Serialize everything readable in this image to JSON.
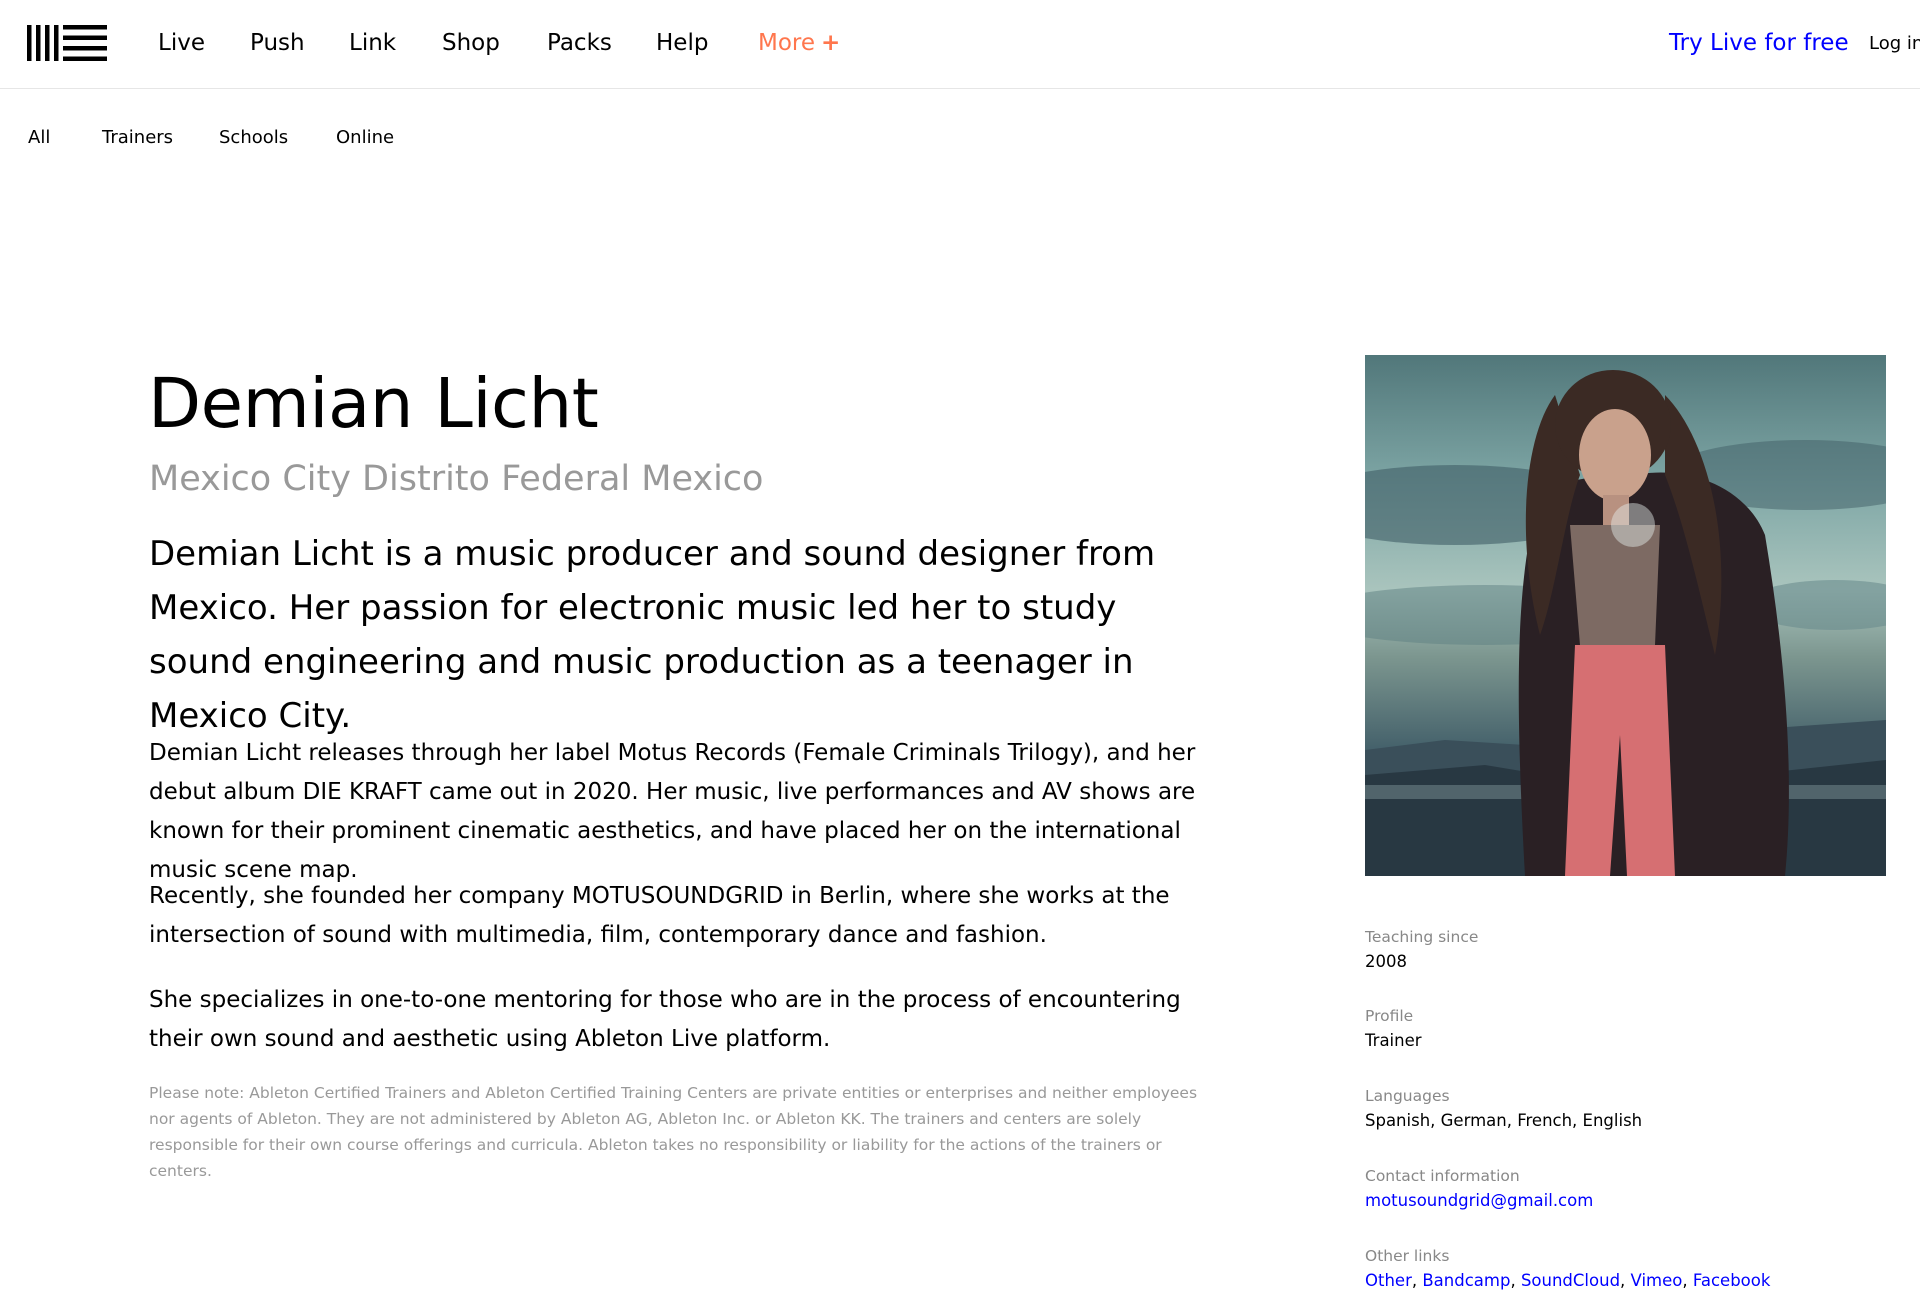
{
  "header": {
    "logo_label": "Ableton",
    "nav": [
      "Live",
      "Push",
      "Link",
      "Shop",
      "Packs",
      "Help"
    ],
    "more_label": "More",
    "more_icon": "+",
    "try_live": "Try Live for free",
    "login": "Log in"
  },
  "subnav": [
    "All",
    "Trainers",
    "Schools",
    "Online"
  ],
  "profile": {
    "name": "Demian Licht",
    "location": "Mexico City Distrito Federal Mexico",
    "intro": "Demian Licht is a music producer and sound designer from Mexico. Her passion for electronic music led her to study sound engineering and music production as a teenager in Mexico City.",
    "paragraphs": [
      "Demian Licht releases through her label Motus Records (Female Criminals Trilogy), and her debut album DIE KRAFT came out in 2020. Her music, live performances and AV shows are known for their prominent cinematic aesthetics, and have placed her on the international music scene map.",
      "Recently, she founded her company MOTUSOUNDGRID in Berlin, where she works at the intersection of sound with multimedia, film, contemporary dance and fashion.",
      "She specializes in one-to-one mentoring for those who are in the process of encountering their own sound and aesthetic using Ableton Live platform."
    ],
    "note": "Please note: Ableton Certified Trainers and Ableton Certified Training Centers are private entities or enterprises and neither employees nor agents of Ableton. They are not administered by Ableton AG, Ableton Inc. or Ableton KK. The trainers and centers are solely responsible for their own course offerings and curricula. Ableton takes no responsibility or liability for the actions of the trainers or centers."
  },
  "info": {
    "teaching_label": "Teaching since",
    "teaching_value": "2008",
    "profile_label": "Profile",
    "profile_value": "Trainer",
    "languages_label": "Languages",
    "languages_value": "Spanish, German, French, English",
    "contact_label": "Contact information",
    "contact_value": "motusoundgrid@gmail.com",
    "links_label": "Other links",
    "links": [
      "Other",
      "Bandcamp",
      "SoundCloud",
      "Vimeo",
      "Facebook"
    ],
    "links_separator": ", "
  },
  "colors": {
    "accent_more": "#ff764d",
    "link": "#0000ff",
    "muted": "#999999"
  },
  "icons": {
    "logo": "ableton-logo-icon",
    "more": "plus-icon"
  }
}
